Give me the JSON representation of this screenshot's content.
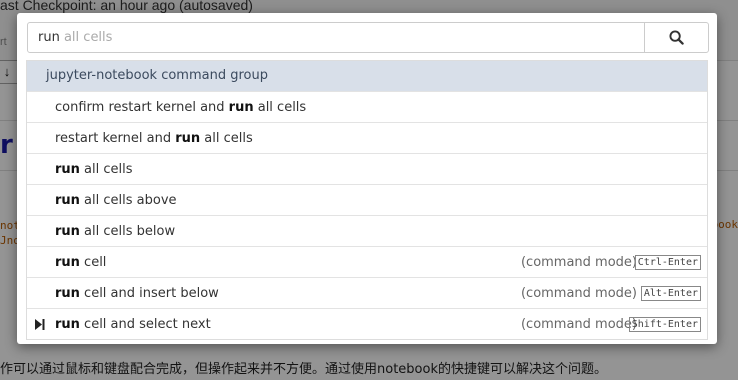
{
  "background": {
    "checkpoint_text": "ast Checkpoint: an hour ago (autosaved)",
    "toolbar_fragment": "rt",
    "title_fragment": "r n",
    "code_left_line1": "noteboo",
    "code_left_line2": "Jnot",
    "code_right": "otebook",
    "bottom_text": "作可以通过鼠标和键盘配合完成，但操作起来并不方便。通过使用notebook的快捷键可以解决这个问题。"
  },
  "palette": {
    "search": {
      "typed": "run",
      "ghost": "all cells",
      "icon": "search-icon"
    },
    "group_header": "jupyter-notebook command group",
    "items": [
      {
        "pre": "confirm restart kernel and ",
        "bold": "run",
        "post": " all cells",
        "mode": "",
        "shortcut": ""
      },
      {
        "pre": "restart kernel and ",
        "bold": "run",
        "post": " all cells",
        "mode": "",
        "shortcut": ""
      },
      {
        "pre": "",
        "bold": "run",
        "post": " all cells",
        "mode": "",
        "shortcut": ""
      },
      {
        "pre": "",
        "bold": "run",
        "post": " all cells above",
        "mode": "",
        "shortcut": ""
      },
      {
        "pre": "",
        "bold": "run",
        "post": " all cells below",
        "mode": "",
        "shortcut": ""
      },
      {
        "pre": "",
        "bold": "run",
        "post": " cell",
        "mode": "(command mode)",
        "shortcut": "Ctrl-Enter"
      },
      {
        "pre": "",
        "bold": "run",
        "post": " cell and insert below",
        "mode": "(command mode)",
        "shortcut": "Alt-Enter"
      },
      {
        "pre": "",
        "bold": "run",
        "post": " cell and select next",
        "mode": "(command mode)",
        "shortcut": "Shift-Enter",
        "icon": "play-next-icon"
      }
    ]
  }
}
